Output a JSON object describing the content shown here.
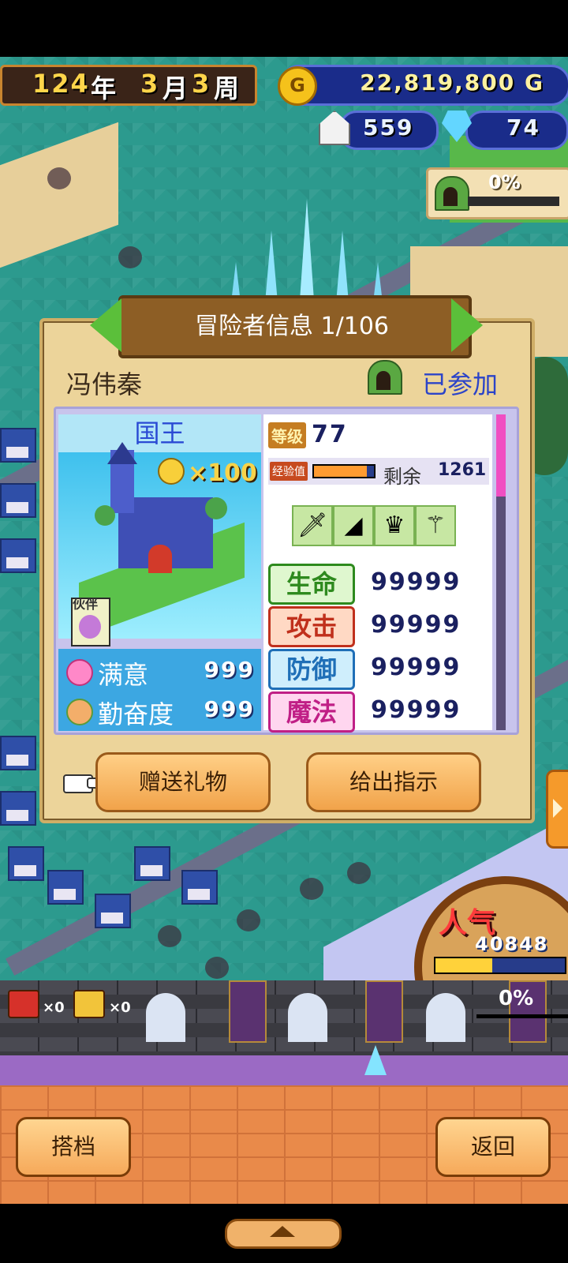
{
  "top": {
    "year": "124",
    "year_unit": "年",
    "month": "3",
    "month_unit": "月",
    "week": "3",
    "week_unit": "周",
    "coin_icon_letter": "G",
    "gold": "22,819,800 G",
    "population": "559",
    "gems": "74",
    "dungeon_percent": "0%"
  },
  "panel": {
    "title": "冒险者信息 1/106",
    "adventurer_name": "冯伟秦",
    "status": "已参加",
    "job": "国王",
    "rank_multiplier": "×100",
    "partner_label": "伙伴",
    "satisfaction_label": "满意",
    "satisfaction_value": "999",
    "diligence_label": "勤奋度",
    "diligence_value": "999",
    "level_label": "等级",
    "level_value": "77",
    "exp_label": "经验值",
    "exp_fill": 0.88,
    "remaining_label": "剩余",
    "remaining_value": "1261",
    "equipment": [
      {
        "name": "sword-icon",
        "glyph": "🗡"
      },
      {
        "name": "cape-icon",
        "glyph": "◢"
      },
      {
        "name": "crown-icon",
        "glyph": "♛"
      },
      {
        "name": "scepter-icon",
        "glyph": "⚚"
      }
    ],
    "stats": [
      {
        "label": "生命",
        "value": "99999",
        "bg": "#dff7cf",
        "fg": "#2e8a1e"
      },
      {
        "label": "攻击",
        "value": "99999",
        "bg": "#ffd9c4",
        "fg": "#c0301c"
      },
      {
        "label": "防御",
        "value": "99999",
        "bg": "#cfeefc",
        "fg": "#1f6fb7"
      },
      {
        "label": "魔法",
        "value": "99999",
        "bg": "#ffd6ef",
        "fg": "#c01f86"
      }
    ],
    "gift_button": "赠送礼物",
    "instruct_button": "给出指示"
  },
  "popularity": {
    "label": "人气",
    "value": "40848",
    "fill": 0.45
  },
  "dungeon": {
    "chest_red_count": "×0",
    "chest_gold_count": "×0",
    "percent": "0%"
  },
  "bottom": {
    "partner_button": "搭档",
    "back_button": "返回"
  },
  "colors": {
    "accent_blue": "#2c44c8",
    "panel_bg": "#ecd49a",
    "button_orange": "#f1a34a"
  }
}
